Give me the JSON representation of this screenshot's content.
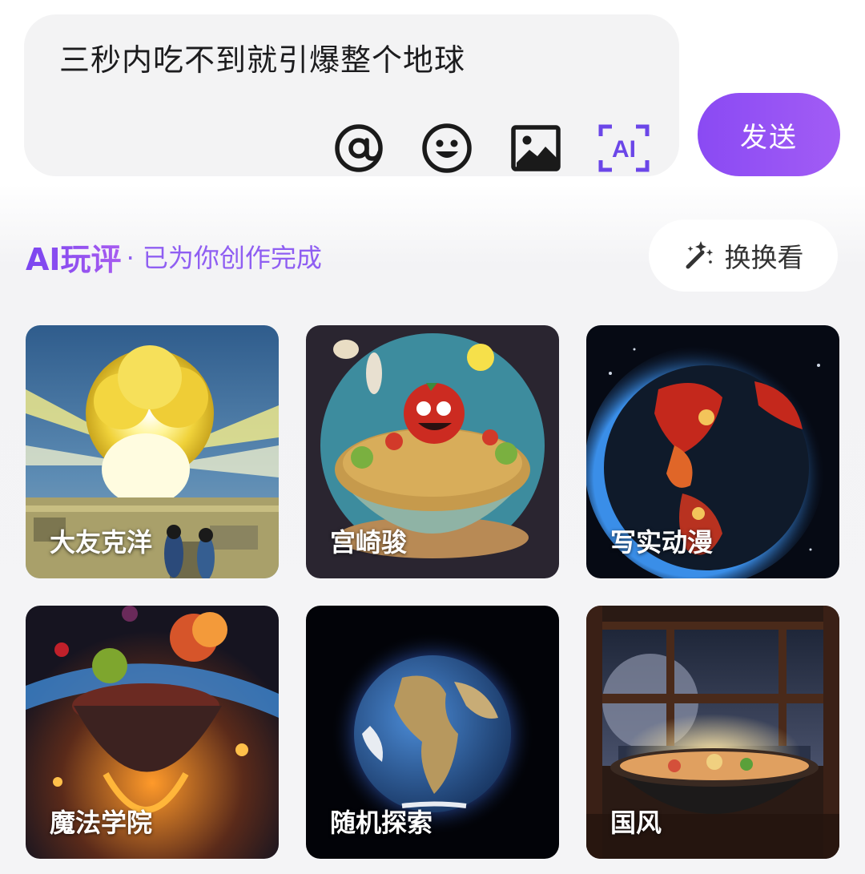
{
  "composer": {
    "text": "三秒内吃不到就引爆整个地球",
    "tools": [
      {
        "name": "at-icon"
      },
      {
        "name": "emoji-icon"
      },
      {
        "name": "image-icon"
      },
      {
        "name": "ai-icon",
        "label": "AI"
      }
    ],
    "send_label": "发送"
  },
  "section": {
    "title": "AI玩评",
    "subtitle": "· 已为你创作完成",
    "shuffle_label": "换换看",
    "shuffle_icon": "magic-wand-icon"
  },
  "styles": [
    {
      "label": "大友克洋"
    },
    {
      "label": "宫崎骏"
    },
    {
      "label": "写实动漫"
    },
    {
      "label": "魔法学院"
    },
    {
      "label": "随机探索"
    },
    {
      "label": "国风"
    }
  ],
  "colors": {
    "accent": "#8a4af3",
    "accent_light": "#a25cf5",
    "ai_icon": "#6b46e8"
  }
}
